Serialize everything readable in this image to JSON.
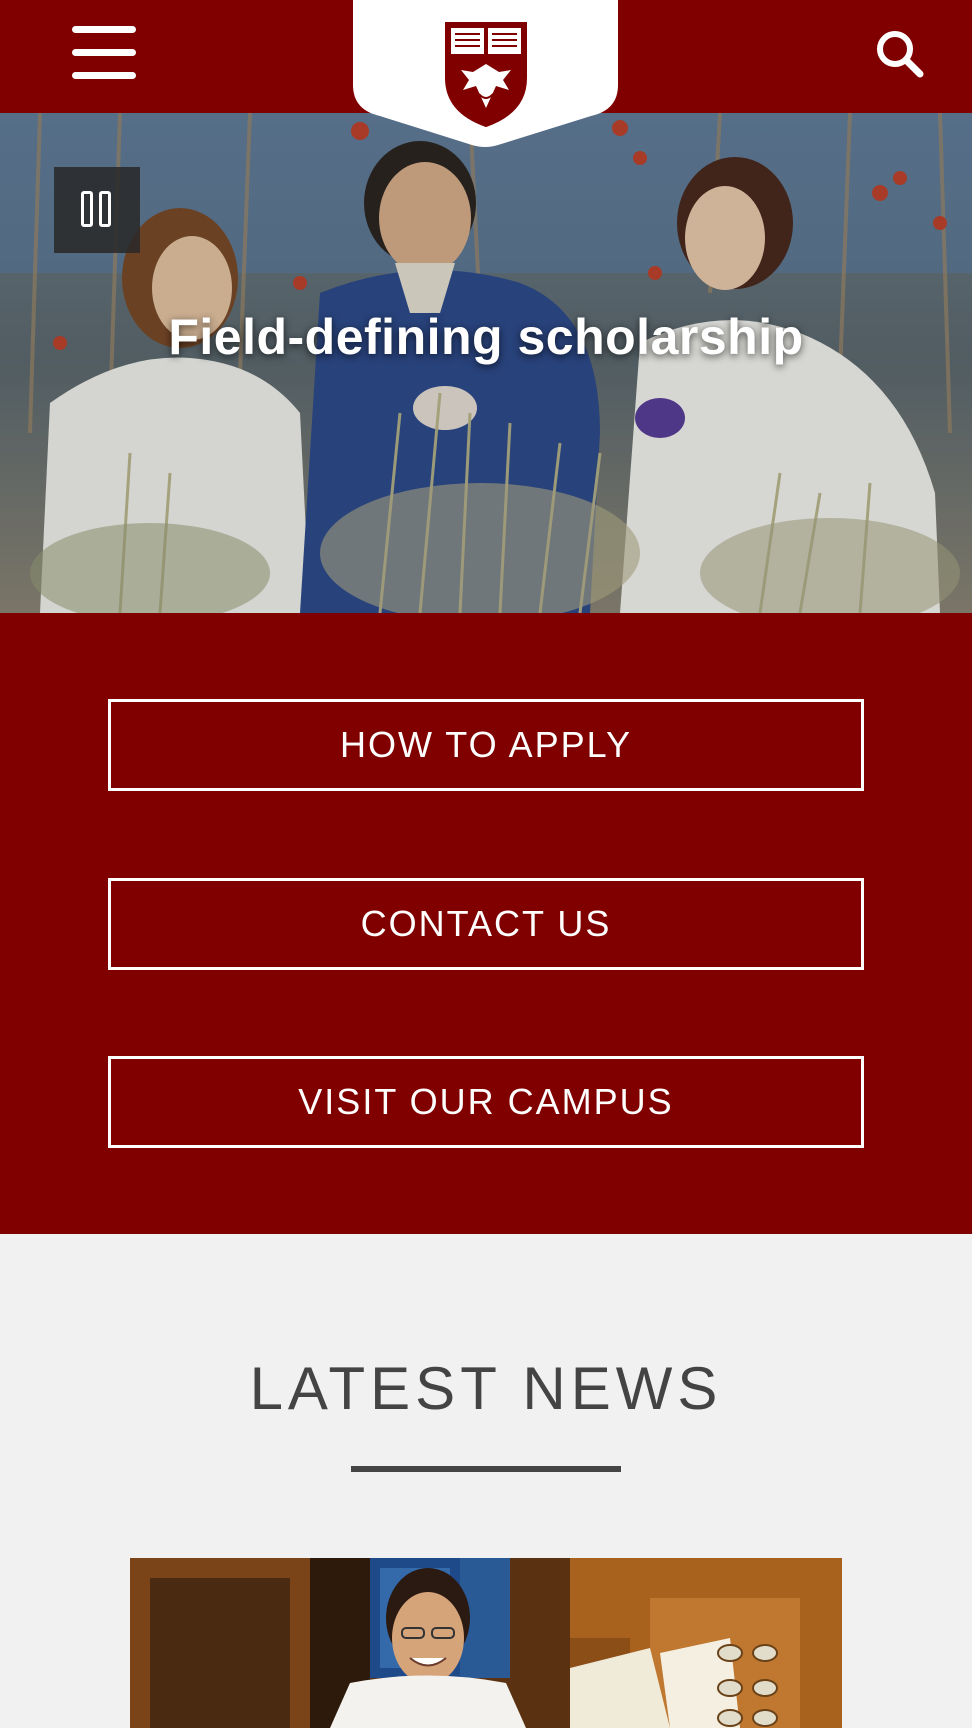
{
  "header": {
    "menu_icon": "hamburger-menu-icon",
    "search_icon": "search-icon",
    "logo": {
      "icon": "university-crest-icon",
      "motto_left": "crescat scientia",
      "motto_right": "vita excolatur"
    }
  },
  "hero": {
    "title": "Field-defining scholarship",
    "pause_icon": "pause-icon"
  },
  "cta": {
    "buttons": [
      {
        "label": "HOW TO APPLY"
      },
      {
        "label": "CONTACT US"
      },
      {
        "label": "VISIT OUR CAMPUS"
      }
    ]
  },
  "news": {
    "title": "LATEST NEWS"
  },
  "colors": {
    "maroon": "#800000",
    "background": "#f1f1f1",
    "text_dark": "#444444",
    "white": "#ffffff"
  }
}
